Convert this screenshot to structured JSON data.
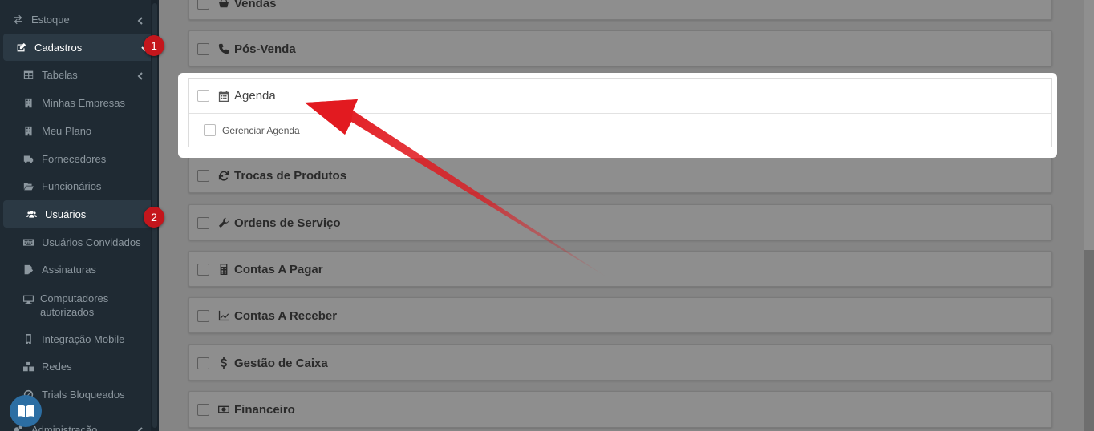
{
  "sidebar": {
    "items": [
      {
        "label": "Estoque",
        "icon": "exchange-icon"
      },
      {
        "label": "Cadastros",
        "icon": "edit-icon"
      },
      {
        "label": "Tabelas",
        "icon": "table-icon"
      },
      {
        "label": "Minhas Empresas",
        "icon": "building-icon"
      },
      {
        "label": "Meu Plano",
        "icon": "building-icon"
      },
      {
        "label": "Fornecedores",
        "icon": "truck-icon"
      },
      {
        "label": "Funcionários",
        "icon": "folder-open-icon"
      },
      {
        "label": "Usuários",
        "icon": "users-icon"
      },
      {
        "label": "Usuários Convidados",
        "icon": "keyboard-icon"
      },
      {
        "label": "Assinaturas",
        "icon": "signature-icon"
      },
      {
        "label": "Computadores autorizados",
        "icon": "desktop-icon"
      },
      {
        "label": "Integração Mobile",
        "icon": "mobile-icon"
      },
      {
        "label": "Redes",
        "icon": "cubes-icon"
      },
      {
        "label": "Trials Bloqueados",
        "icon": "ban-icon"
      },
      {
        "label": "Administração",
        "icon": "cogs-icon"
      }
    ]
  },
  "annotations": {
    "step1": "1",
    "step2": "2"
  },
  "panels": [
    {
      "label": "Vendas",
      "icon": "basket-icon"
    },
    {
      "label": "Pós-Venda",
      "icon": "phone-icon"
    },
    {
      "label": "Trocas de Produtos",
      "icon": "refresh-icon"
    },
    {
      "label": "Ordens de Serviço",
      "icon": "wrench-icon"
    },
    {
      "label": "Contas A Pagar",
      "icon": "calculator-icon"
    },
    {
      "label": "Contas A Receber",
      "icon": "line-chart-icon"
    },
    {
      "label": "Gestão de Caixa",
      "icon": "dollar-icon"
    },
    {
      "label": "Financeiro",
      "icon": "money-icon"
    }
  ],
  "agenda": {
    "label": "Agenda",
    "icon": "calendar-icon",
    "sub_label": "Gerenciar Agenda"
  },
  "colors": {
    "sidebar_bg": "#1f2a33",
    "badge": "#c4161c",
    "arrow": "#e0161c",
    "help_button": "#2c6ea3"
  }
}
